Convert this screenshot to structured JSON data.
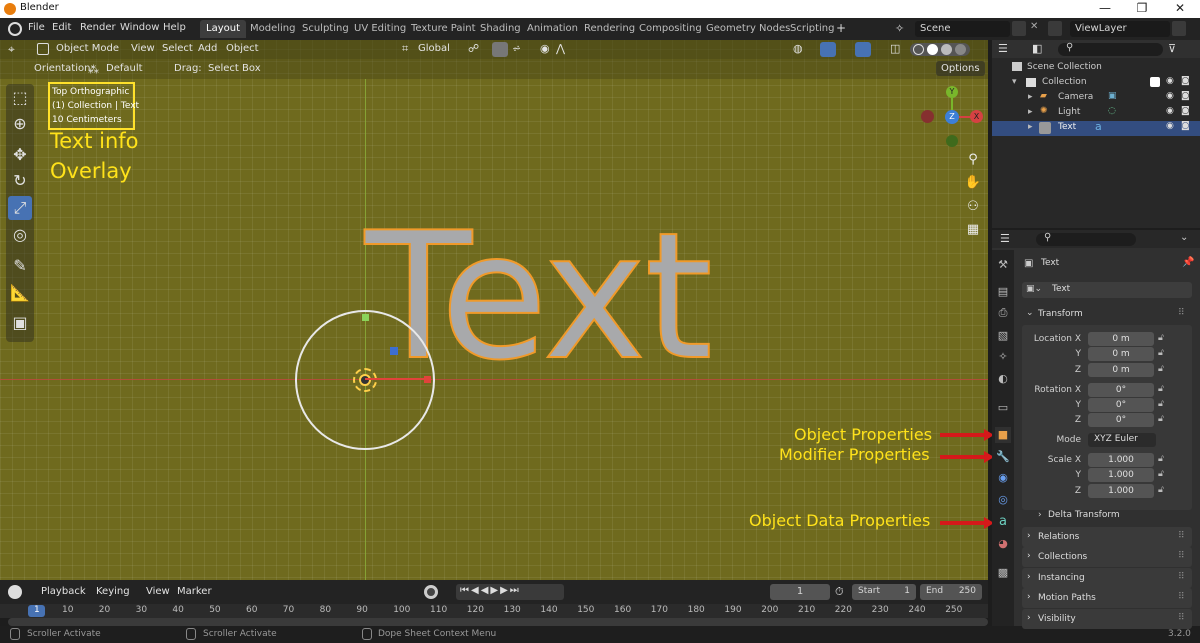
{
  "window": {
    "title": "Blender",
    "min": "—",
    "max": "❐",
    "close": "✕"
  },
  "menus": [
    "File",
    "Edit",
    "Render",
    "Window",
    "Help"
  ],
  "workspaces": [
    "Layout",
    "Modeling",
    "Sculpting",
    "UV Editing",
    "Texture Paint",
    "Shading",
    "Animation",
    "Rendering",
    "Compositing",
    "Geometry Nodes",
    "Scripting"
  ],
  "add_ws": "+",
  "scene": "Scene",
  "viewlayer": "ViewLayer",
  "viewport": {
    "mode": "Object Mode",
    "menus": [
      "View",
      "Select",
      "Add",
      "Object"
    ],
    "transform": "Global",
    "orientation_label": "Orientation:",
    "orientation": "Default",
    "drag_label": "Drag:",
    "drag": "Select Box",
    "options": "Options"
  },
  "overlay": {
    "line1": "Top Orthographic",
    "line2": "(1) Collection | Text",
    "line3": "10 Centimeters"
  },
  "annotations": {
    "text_info": "Text info",
    "overlay": "Overlay",
    "object_props": "Object Properties",
    "modifier_props": "Modifier Properties",
    "object_data_props": "Object Data Properties"
  },
  "big_text": "Text",
  "gizmo": {
    "y": "Y",
    "z": "Z",
    "x": "X"
  },
  "timeline": {
    "playback": "Playback",
    "keying": "Keying",
    "view": "View",
    "marker": "Marker",
    "current": "1",
    "start_label": "Start",
    "start": "1",
    "end_label": "End",
    "end": "250",
    "ticks": [
      "1",
      "10",
      "20",
      "30",
      "40",
      "50",
      "60",
      "70",
      "80",
      "90",
      "100",
      "110",
      "120",
      "130",
      "140",
      "150",
      "160",
      "170",
      "180",
      "190",
      "200",
      "210",
      "220",
      "230",
      "240",
      "250"
    ]
  },
  "status": {
    "left": "Scroller Activate",
    "mid": "Scroller Activate",
    "right": "Dope Sheet Context Menu",
    "version": "3.2.0"
  },
  "outliner": {
    "scene_collection": "Scene Collection",
    "collection": "Collection",
    "items": [
      "Camera",
      "Light",
      "Text"
    ]
  },
  "props": {
    "object_name": "Text",
    "data_name": "Text",
    "transform": "Transform",
    "location_x": "Location X",
    "y": "Y",
    "z": "Z",
    "rotation_x": "Rotation X",
    "mode_label": "Mode",
    "mode": "XYZ Euler",
    "scale_x": "Scale X",
    "loc": [
      "0 m",
      "0 m",
      "0 m"
    ],
    "rot": [
      "0°",
      "0°",
      "0°"
    ],
    "scale": [
      "1.000",
      "1.000",
      "1.000"
    ],
    "panels": [
      "Delta Transform",
      "Relations",
      "Collections",
      "Instancing",
      "Motion Paths",
      "Visibility"
    ]
  }
}
